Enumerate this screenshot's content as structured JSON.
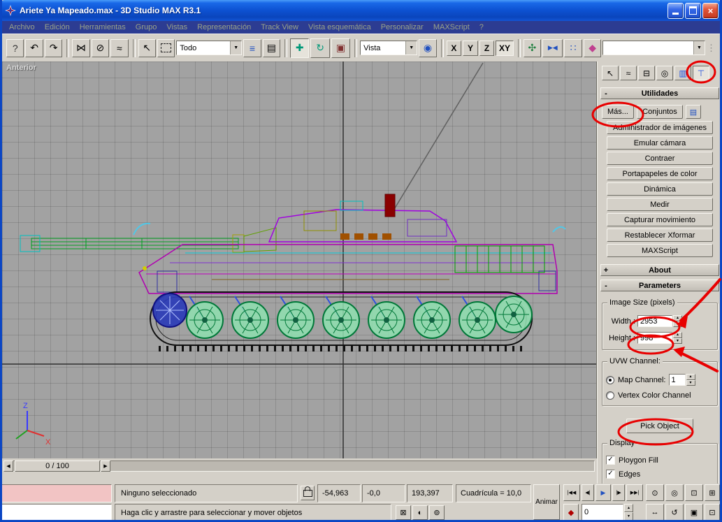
{
  "window": {
    "title": "Ariete Ya Mapeado.max - 3D Studio MAX R3.1"
  },
  "menubar": {
    "items": [
      "Archivo",
      "Edición",
      "Herramientas",
      "Grupo",
      "Vistas",
      "Representación",
      "Track View",
      "Vista esquemática",
      "Personalizar",
      "MAXScript",
      "?"
    ]
  },
  "toolbar": {
    "select_filter_value": "Todo",
    "coord_system_value": "Vista",
    "axis_buttons": [
      "X",
      "Y",
      "Z",
      "XY"
    ]
  },
  "viewport": {
    "label": "Anterior",
    "axis_z": "Z",
    "axis_x": "X"
  },
  "timeline": {
    "slider_label": "0 / 100"
  },
  "command_panel": {
    "utilities_rollout": {
      "collapse": "-",
      "title": "Utilidades"
    },
    "more_button": "Más...",
    "sets_button": "Conjuntos",
    "utility_buttons": [
      "Administrador de imágenes",
      "Emular cámara",
      "Contraer",
      "Portapapeles de color",
      "Dinámica",
      "Medir",
      "Capturar movimiento",
      "Restablecer Xformar",
      "MAXScript"
    ],
    "about_rollout": {
      "collapse": "+",
      "title": "About"
    },
    "parameters_rollout": {
      "collapse": "-",
      "title": "Parameters"
    },
    "image_size": {
      "group_title": "Image Size (pixels)",
      "width_label": "Width :",
      "width_value": "2953",
      "height_label": "Height :",
      "height_value": "998"
    },
    "uvw": {
      "group_title": "UVW Channel:",
      "map_channel_label": "Map Channel:",
      "map_channel_value": "1",
      "vertex_color_label": "Vertex Color Channel"
    },
    "pick_object_button": "Pick Object",
    "display_group": {
      "title": "Display",
      "polygon_fill_label": "Ploygon Fill",
      "edge_label": "Edges"
    }
  },
  "statusbar": {
    "selection_status": "Ninguno seleccionado",
    "coord_x": "-54,963",
    "coord_y": "-0,0",
    "coord_z": "193,397",
    "grid_size": "Cuadrícula = 10,0",
    "animate_button": "Animar",
    "prompt": "Haga clic y arrastre para seleccionar y mover objetos",
    "frame_field": "0"
  },
  "icons": {
    "close": "×",
    "undo": "↶",
    "redo": "↷",
    "select_link": "⋈",
    "unlink": "⊘",
    "bind_spacewarp": "≈",
    "select_object": "↖",
    "select_filter": "≡",
    "select_by_name": "▤",
    "move": "✚",
    "rotate": "↻",
    "scale": "▣",
    "coord_pivot": "◉",
    "manipulate": "✣",
    "mirror": "▶◀",
    "array": "∷",
    "align": "◆",
    "dropdown": "▼",
    "grip": "⋮",
    "spin_up": "▴",
    "spin_down": "▾",
    "check": "✓",
    "tab_create": "↖",
    "tab_modify": "≈",
    "tab_hierarchy": "⊟",
    "tab_motion": "◎",
    "tab_display": "▥",
    "tab_utilities": "⊤",
    "slider_prev": "◀",
    "slider_next": "▶",
    "go_start": "|◀◀",
    "prev_frame": "◀|",
    "play": "▶",
    "next_frame": "|▶",
    "go_end": "▶▶|",
    "key_mode": "◆",
    "zoom": "⊙",
    "zoom_all": "◎",
    "zoom_extents": "⊡",
    "zoom_region": "⊞",
    "pan": "↔",
    "arc_rotate": "↺",
    "min_max": "▣",
    "crossing": "⊠",
    "degradation": "◐",
    "snap": "⊚",
    "sets_list": "▤"
  }
}
